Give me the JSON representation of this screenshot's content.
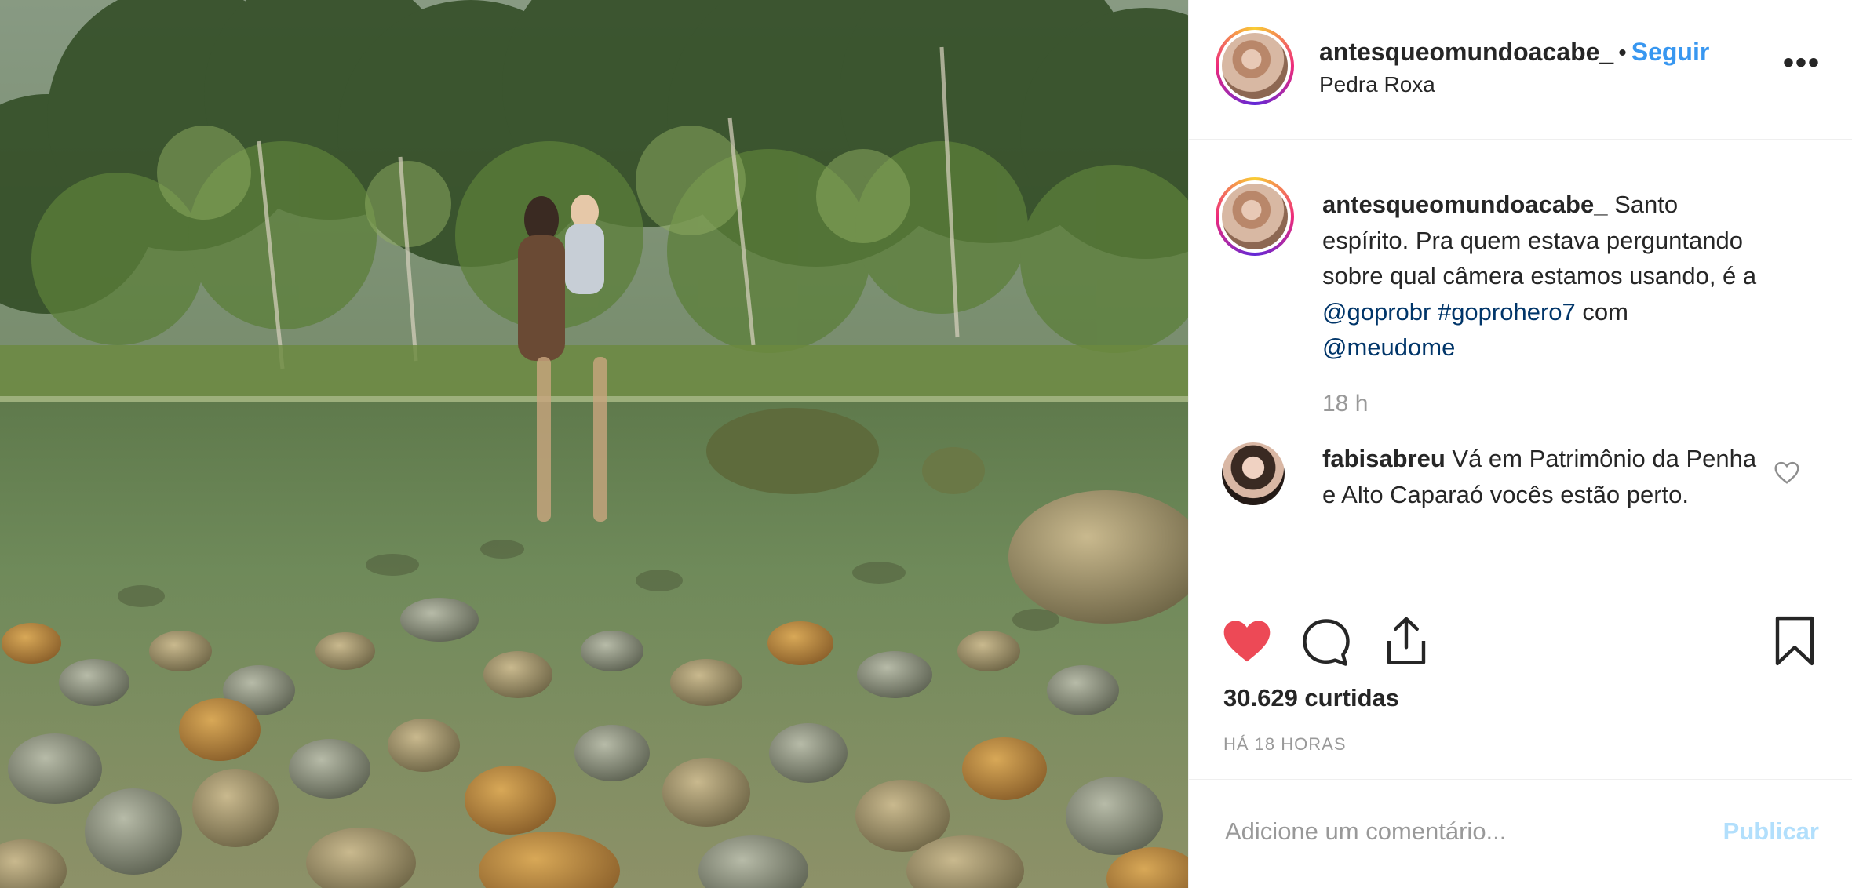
{
  "post": {
    "username": "antesqueomundoacabe_",
    "separator": "•",
    "follow_label": "Seguir",
    "location": "Pedra Roxa",
    "more_icon": "more-options-icon"
  },
  "caption": {
    "username": "antesqueomundoacabe_",
    "text_1": "Santo espírito. Pra quem estava perguntando sobre qual câmera estamos usando, é a",
    "mention_1": "@goprobr",
    "hashtag": "#goprohero7",
    "text_2": "com",
    "mention_2": "@meudome",
    "time": "18 h"
  },
  "comment": {
    "username": "fabisabreu",
    "text": "Vá em Patrimônio da Penha e Alto Caparaó vocês estão perto."
  },
  "actions": {
    "likes": "30.629 curtidas",
    "posted": "HÁ 18 HORAS",
    "like_color": "#ed4956"
  },
  "add_comment": {
    "placeholder": "Adicione um comentário...",
    "publish_label": "Publicar"
  },
  "colors": {
    "link": "#003569",
    "follow": "#3897f0",
    "muted": "#999999",
    "publish_disabled": "#b2dffc"
  }
}
